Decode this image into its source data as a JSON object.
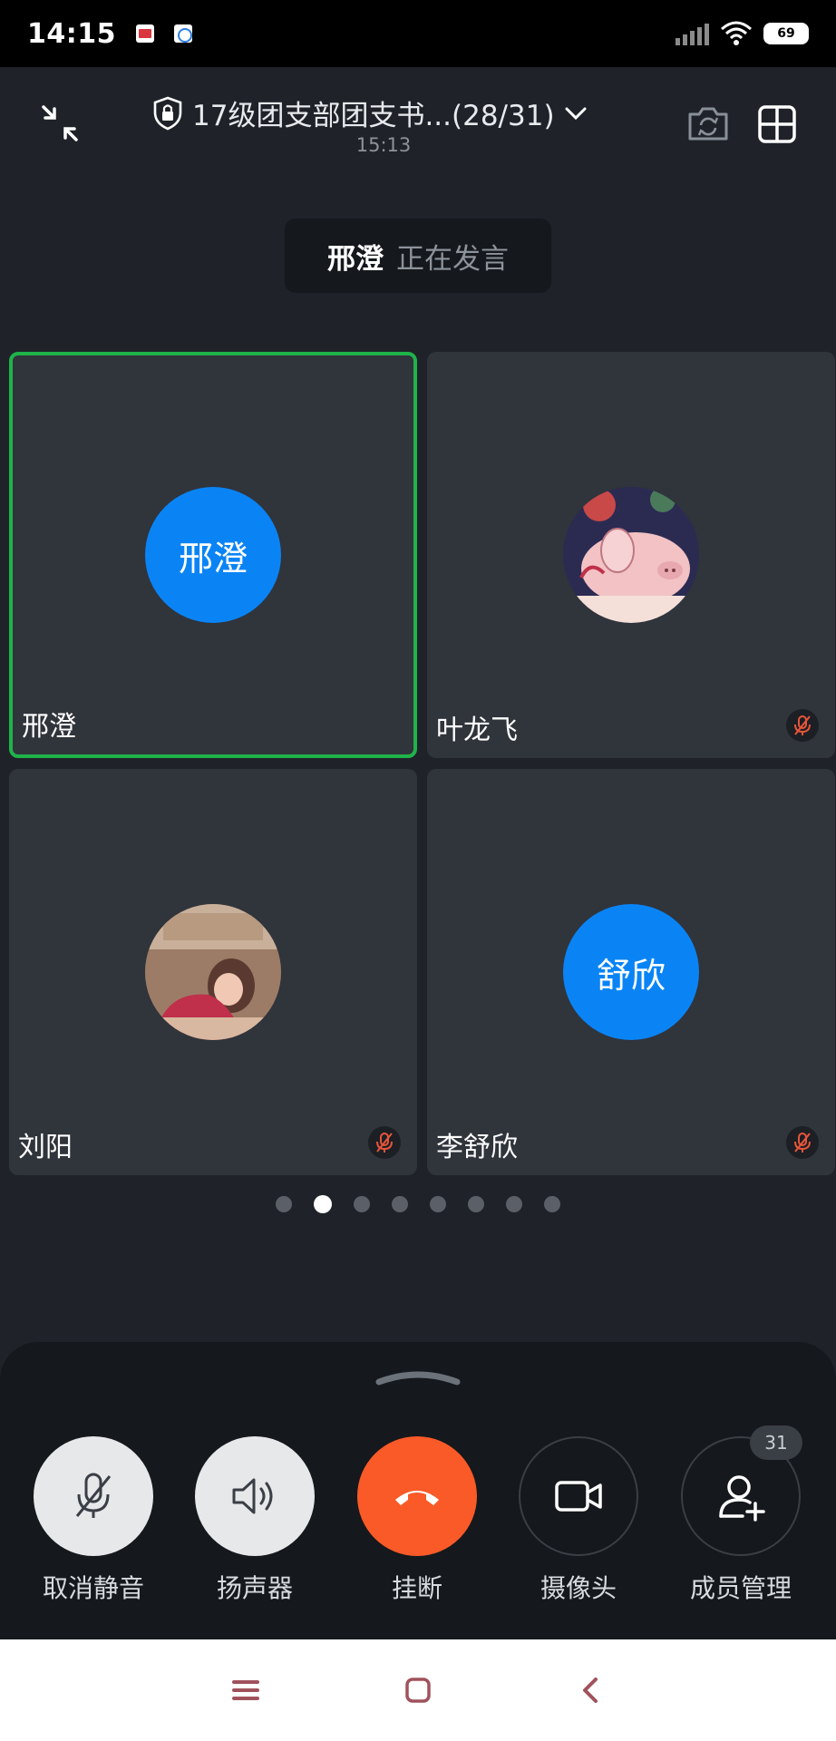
{
  "status_bar": {
    "time": "14:15",
    "battery": "69",
    "icons": [
      "calendar-app-icon",
      "browser-app-icon",
      "signal-icon",
      "wifi-icon",
      "battery-icon"
    ]
  },
  "header": {
    "title": "17级团支部团支书...(28/31)",
    "meeting_time": "15:13",
    "icons": [
      "collapse-icon",
      "lock-shield-icon",
      "chevron-down-icon",
      "switch-camera-icon",
      "grid-layout-icon"
    ]
  },
  "speaking": {
    "name": "邢澄",
    "status": "正在发言"
  },
  "participants": [
    {
      "name": "邢澄",
      "avatar_text": "邢澄",
      "avatar_color": "#0a84f5",
      "active": true,
      "muted": false
    },
    {
      "name": "叶龙飞",
      "avatar_text": "",
      "avatar_image": "pig-illustration",
      "active": false,
      "muted": true
    },
    {
      "name": "刘阳",
      "avatar_text": "",
      "avatar_image": "photo-girl-red-jacket",
      "active": false,
      "muted": true
    },
    {
      "name": "李舒欣",
      "avatar_text": "舒欣",
      "avatar_color": "#0a84f5",
      "active": false,
      "muted": true
    }
  ],
  "pager": {
    "total": 8,
    "current": 2
  },
  "controls": [
    {
      "label": "取消静音",
      "icon": "mic-off-icon"
    },
    {
      "label": "扬声器",
      "icon": "speaker-icon"
    },
    {
      "label": "挂断",
      "icon": "hang-up-icon"
    },
    {
      "label": "摄像头",
      "icon": "camera-icon"
    },
    {
      "label": "成员管理",
      "icon": "add-member-icon",
      "badge": "31"
    }
  ],
  "colors": {
    "background": "#1f2329",
    "tile": "#30343b",
    "active_border": "#1fb34a",
    "avatar_blue": "#0a84f5",
    "hang_up": "#fa5a28",
    "muted_red": "#e8553a"
  }
}
